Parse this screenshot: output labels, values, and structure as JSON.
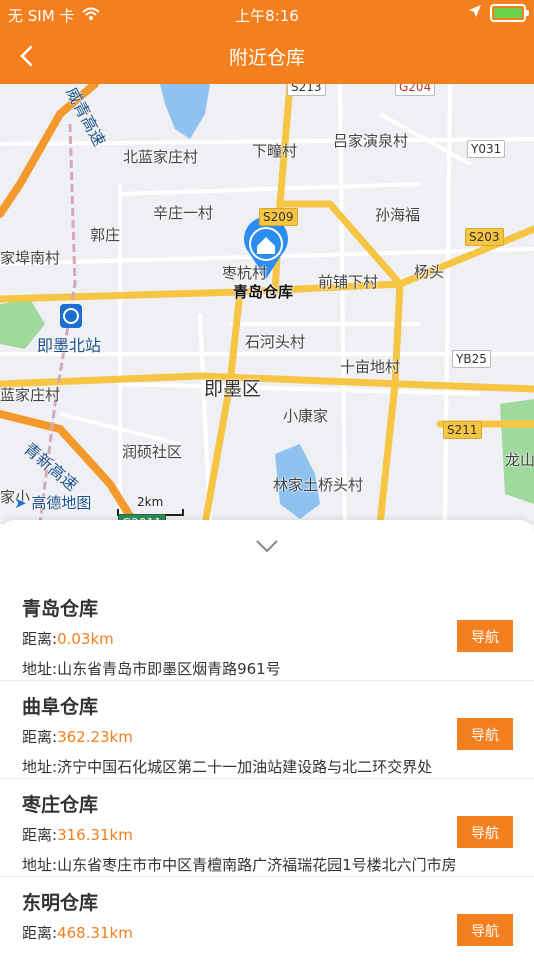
{
  "status_bar": {
    "carrier": "无 SIM 卡",
    "time": "上午8:16",
    "colors": {
      "background": "#f37f1f",
      "battery": "#6ad24a"
    }
  },
  "nav": {
    "title": "附近仓库"
  },
  "map": {
    "labels": {
      "weiqing": "威青高速",
      "beilan": "北蓝家庄村",
      "xiatong": "下疃村",
      "lvjia": "吕家演泉村",
      "xinzhuang": "辛庄一村",
      "sunhaifu": "孙海福",
      "guozhuang": "郭庄",
      "jiafu": "家埠南村",
      "zaohang": "枣杭村",
      "qianpu": "前铺下村",
      "yangtou": "杨头",
      "station": "即墨北站",
      "shihe": "石河头村",
      "shimu": "十亩地村",
      "lanjia": "蓝家庄村",
      "jimo": "即墨区",
      "xiaokang": "小康家",
      "qingxin": "青新高速",
      "runshuo": "润硕社区",
      "linjia": "林家土桥头村",
      "longshan": "龙山",
      "jia": "家小",
      "amap": "高德地图",
      "scale": "2km",
      "marker": "青岛仓库"
    },
    "roads": {
      "s213": "S213",
      "g204": "G204",
      "y031": "Y031",
      "s209": "S209",
      "s203": "S203",
      "yb25": "YB25",
      "s211": "S211",
      "g2011": "G2011"
    }
  },
  "list": {
    "distance_prefix": "距离:",
    "address_prefix": "地址:",
    "nav_label": "导航",
    "items": [
      {
        "name": "青岛仓库",
        "distance": "0.03km",
        "address": "山东省青岛市即墨区烟青路961号"
      },
      {
        "name": "曲阜仓库",
        "distance": "362.23km",
        "address": "济宁中国石化城区第二十一加油站建设路与北二环交界处"
      },
      {
        "name": "枣庄仓库",
        "distance": "316.31km",
        "address": "山东省枣庄市市中区青檀南路广济福瑞花园1号楼北六门市房"
      },
      {
        "name": "东明仓库",
        "distance": "468.31km",
        "address": ""
      }
    ]
  },
  "colors": {
    "accent": "#f37f1f",
    "marker": "#2d8cf0"
  }
}
